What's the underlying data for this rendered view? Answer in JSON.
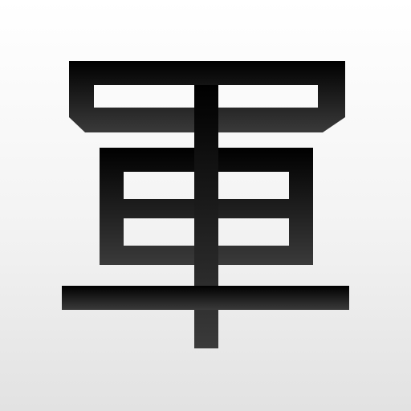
{
  "icon": {
    "name": "army-kanji-app-icon",
    "glyph_character": "軍",
    "colors": {
      "background_top": "#ffffff",
      "background_bottom": "#e2e2e2",
      "glyph_top": "#000000",
      "glyph_bottom": "#3a3a3a"
    }
  }
}
